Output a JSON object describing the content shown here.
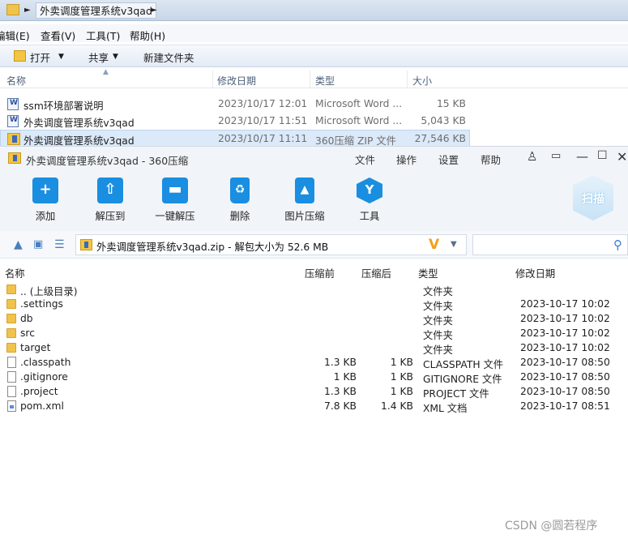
{
  "explorer": {
    "breadcrumb": "外卖调度管理系统v3qad",
    "menu": [
      "编辑(E)",
      "查看(V)",
      "工具(T)",
      "帮助(H)"
    ],
    "toolbar": {
      "open": "打开",
      "share": "共享",
      "new_folder": "新建文件夹"
    },
    "columns": {
      "name": "名称",
      "date": "修改日期",
      "type": "类型",
      "size": "大小"
    },
    "files": [
      {
        "name": "ssm环境部署说明",
        "date": "2023/10/17 12:01",
        "type": "Microsoft Word ...",
        "size": "15 KB",
        "icon": "word-doc-icon"
      },
      {
        "name": "外卖调度管理系统v3qad",
        "date": "2023/10/17 11:51",
        "type": "Microsoft Word ...",
        "size": "5,043 KB",
        "icon": "word-doc-icon"
      },
      {
        "name": "外卖调度管理系统v3qad",
        "date": "2023/10/17 11:11",
        "type": "360压缩 ZIP 文件",
        "size": "27,546 KB",
        "icon": "zip-icon"
      }
    ]
  },
  "zip": {
    "title": "外卖调度管理系统v3qad - 360压缩",
    "menu": [
      "文件",
      "操作",
      "设置",
      "帮助"
    ],
    "tools": [
      {
        "label": "添加",
        "icon": "add-icon"
      },
      {
        "label": "解压到",
        "icon": "extract-to-icon"
      },
      {
        "label": "一键解压",
        "icon": "one-click-extract-icon"
      },
      {
        "label": "删除",
        "icon": "delete-icon"
      },
      {
        "label": "图片压缩",
        "icon": "image-compress-icon"
      },
      {
        "label": "工具",
        "icon": "tools-icon"
      }
    ],
    "scan_label": "扫描",
    "path": "外卖调度管理系统v3qad.zip - 解包大小为 52.6 MB",
    "columns": {
      "name": "名称",
      "before": "压缩前",
      "after": "压缩后",
      "type": "类型",
      "date": "修改日期"
    },
    "entries": [
      {
        "name": ".. (上级目录)",
        "before": "",
        "after": "",
        "type": "文件夹",
        "date": "",
        "kind": "folder"
      },
      {
        "name": ".settings",
        "before": "",
        "after": "",
        "type": "文件夹",
        "date": "2023-10-17 10:02",
        "kind": "folder"
      },
      {
        "name": "db",
        "before": "",
        "after": "",
        "type": "文件夹",
        "date": "2023-10-17 10:02",
        "kind": "folder"
      },
      {
        "name": "src",
        "before": "",
        "after": "",
        "type": "文件夹",
        "date": "2023-10-17 10:02",
        "kind": "folder"
      },
      {
        "name": "target",
        "before": "",
        "after": "",
        "type": "文件夹",
        "date": "2023-10-17 10:02",
        "kind": "folder"
      },
      {
        "name": ".classpath",
        "before": "1.3 KB",
        "after": "1 KB",
        "type": "CLASSPATH 文件",
        "date": "2023-10-17 08:50",
        "kind": "file"
      },
      {
        "name": ".gitignore",
        "before": "1 KB",
        "after": "1 KB",
        "type": "GITIGNORE 文件",
        "date": "2023-10-17 08:50",
        "kind": "file"
      },
      {
        "name": ".project",
        "before": "1.3 KB",
        "after": "1 KB",
        "type": "PROJECT 文件",
        "date": "2023-10-17 08:50",
        "kind": "file"
      },
      {
        "name": "pom.xml",
        "before": "7.8 KB",
        "after": "1.4 KB",
        "type": "XML 文档",
        "date": "2023-10-17 08:51",
        "kind": "xml"
      }
    ]
  },
  "watermark": "CSDN @圆若程序"
}
